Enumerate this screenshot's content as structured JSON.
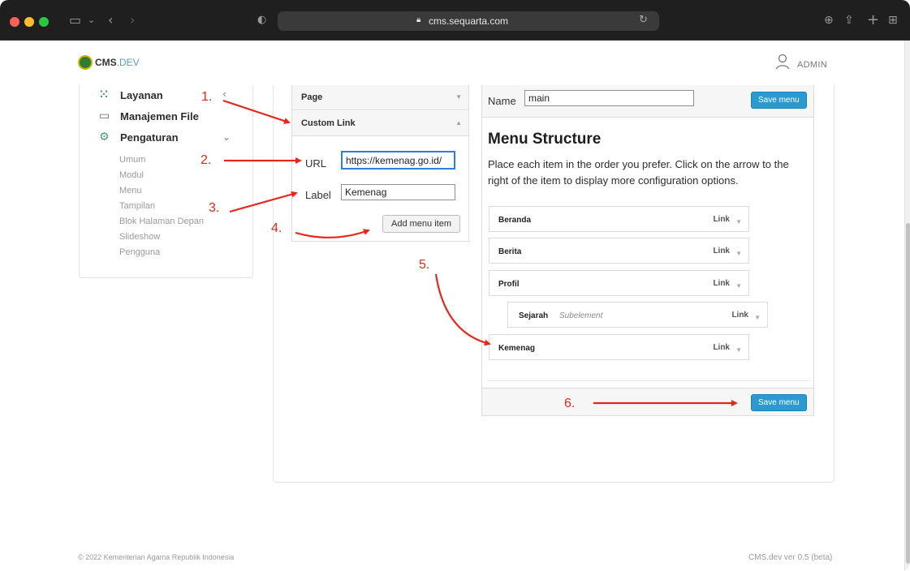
{
  "browser": {
    "url": "cms.sequarta.com"
  },
  "header": {
    "logo_main": "CMS",
    "logo_accent": ".DEV",
    "user_label": "ADMIN"
  },
  "sidebar": {
    "items": [
      {
        "label": "Layanan",
        "icon": "grid-dots-icon"
      },
      {
        "label": "Manajemen File",
        "icon": "folder-icon"
      },
      {
        "label": "Pengaturan",
        "icon": "gear-icon"
      }
    ],
    "settings_sub": [
      "Umum",
      "Modul",
      "Menu",
      "Tampilan",
      "Blok Halaman Depan",
      "Slideshow",
      "Pengguna"
    ]
  },
  "accordion": {
    "page_label": "Page",
    "custom_link_label": "Custom Link",
    "url_label": "URL",
    "url_value": "https://kemenag.go.id/",
    "label_label": "Label",
    "label_value": "Kemenag",
    "add_button": "Add menu item"
  },
  "menu": {
    "name_label": "Name",
    "name_value": "main",
    "save_button": "Save menu",
    "title": "Menu Structure",
    "description": "Place each item in the order you prefer. Click on the arrow to the right of the item to display more configuration options.",
    "items": [
      {
        "label": "Beranda",
        "type": "Link"
      },
      {
        "label": "Berita",
        "type": "Link"
      },
      {
        "label": "Profil",
        "type": "Link"
      },
      {
        "label": "Sejarah",
        "type": "Link",
        "sub": "Subelement"
      },
      {
        "label": "Kemenag",
        "type": "Link"
      }
    ]
  },
  "annotations": {
    "steps": [
      "1.",
      "2.",
      "3.",
      "4.",
      "5.",
      "6."
    ],
    "color": "#e8261b"
  },
  "footer": {
    "copyright": "© 2022 Kementerian Agama Republik Indonesia",
    "version": "CMS.dev ver 0.5 (beta)"
  },
  "colors": {
    "primary_button": "#2c9ad1",
    "accent_green": "#4a9a6a"
  }
}
